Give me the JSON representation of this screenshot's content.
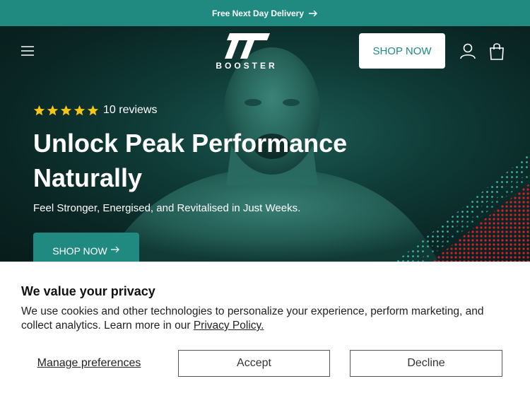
{
  "announcement": {
    "text": "Free Next Day Delivery"
  },
  "header": {
    "logo_text": "BOOSTER",
    "shop_button": "SHOP NOW"
  },
  "hero": {
    "rating": {
      "stars": 5,
      "text": "10 reviews"
    },
    "title": "Unlock Peak Performance Naturally",
    "subtitle": "Feel Stronger, Energised, and Revitalised in Just Weeks.",
    "cta": "SHOP NOW"
  },
  "consent": {
    "title": "We value your privacy",
    "body": "We use cookies and other technologies to personalize your experience, perform marketing, and collect analytics. Learn more in our ",
    "link": "Privacy Policy.",
    "manage": "Manage preferences",
    "accept": "Accept",
    "decline": "Decline"
  },
  "colors": {
    "brand": "#218a80",
    "hero_bg": "#0f3a36",
    "star": "#f5c518",
    "accent_red": "#e11b2a"
  }
}
